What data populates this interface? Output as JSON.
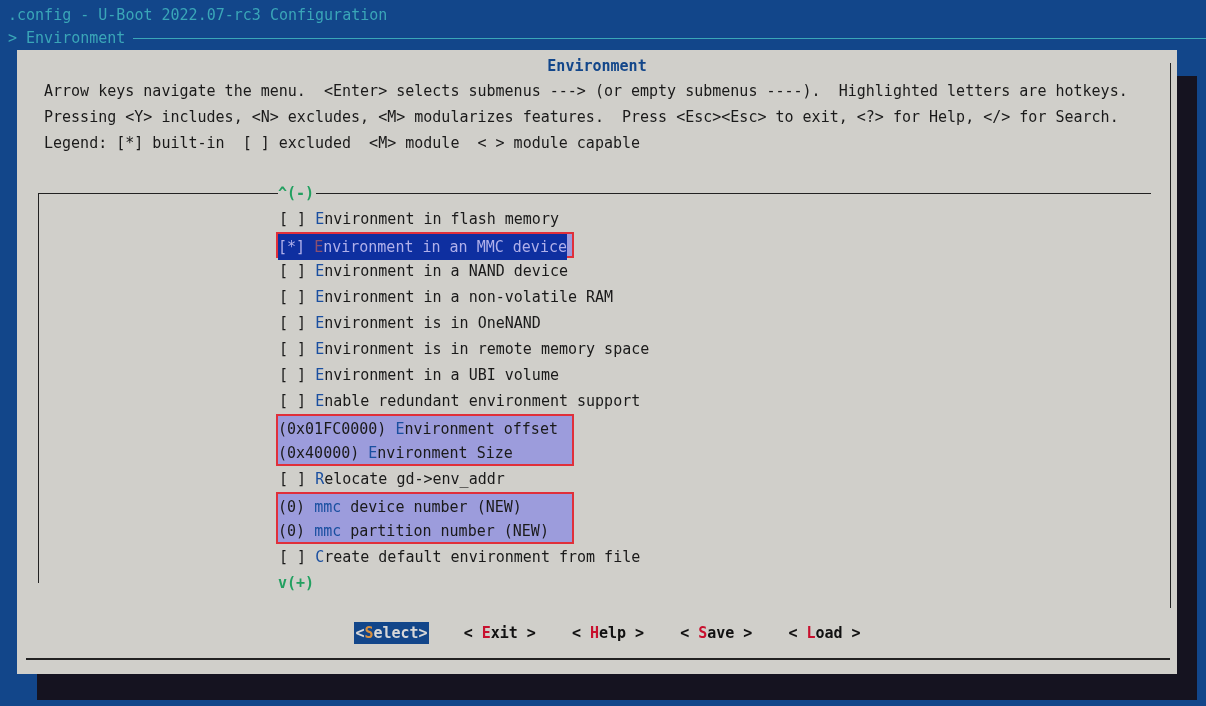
{
  "window": {
    "title": ".config - U-Boot 2022.07-rc3 Configuration"
  },
  "breadcrumb": "> Environment",
  "dialog": {
    "title": "Environment",
    "help_lines": [
      "Arrow keys navigate the menu.  <Enter> selects submenus ---> (or empty submenus ----).  Highlighted letters are hotkeys.",
      "Pressing <Y> includes, <N> excludes, <M> modularizes features.  Press <Esc><Esc> to exit, <?> for Help, </> for Search.",
      "Legend: [*] built-in  [ ] excluded  <M> module  < > module capable"
    ],
    "scroll_up": "^(-)",
    "scroll_down": "v(+)",
    "items": [
      {
        "prefix": "[ ]",
        "hotkey": "E",
        "rest": "nvironment in flash memory",
        "selected": false,
        "marked": false
      },
      {
        "prefix": "[*]",
        "hotkey": "E",
        "rest": "nvironment in an MMC device",
        "selected": true,
        "marked": true
      },
      {
        "prefix": "[ ]",
        "hotkey": "E",
        "rest": "nvironment in a NAND device",
        "selected": false,
        "marked": false
      },
      {
        "prefix": "[ ]",
        "hotkey": "E",
        "rest": "nvironment in a non-volatile RAM",
        "selected": false,
        "marked": false
      },
      {
        "prefix": "[ ]",
        "hotkey": "E",
        "rest": "nvironment is in OneNAND",
        "selected": false,
        "marked": false
      },
      {
        "prefix": "[ ]",
        "hotkey": "E",
        "rest": "nvironment is in remote memory space",
        "selected": false,
        "marked": false
      },
      {
        "prefix": "[ ]",
        "hotkey": "E",
        "rest": "nvironment in a UBI volume",
        "selected": false,
        "marked": false
      },
      {
        "prefix": "[ ]",
        "hotkey": "E",
        "rest": "nable redundant environment support",
        "selected": false,
        "marked": false
      },
      {
        "prefix": "(0x01FC0000)",
        "hotkey": "E",
        "rest": "nvironment offset",
        "selected": false,
        "marked": true
      },
      {
        "prefix": "(0x40000)",
        "hotkey": "E",
        "rest": "nvironment Size",
        "selected": false,
        "marked": true
      },
      {
        "prefix": "[ ]",
        "hotkey": "R",
        "rest": "elocate gd->env_addr",
        "selected": false,
        "marked": false
      },
      {
        "prefix": "(0)",
        "hotkey": "mmc",
        "rest": " device number (NEW)",
        "selected": false,
        "marked": true
      },
      {
        "prefix": "(0)",
        "hotkey": "mmc",
        "rest": " partition number (NEW)",
        "selected": false,
        "marked": true
      },
      {
        "prefix": "[ ]",
        "hotkey": "C",
        "rest": "reate default environment from file",
        "selected": false,
        "marked": false
      }
    ],
    "buttons": [
      {
        "open": "<",
        "hotkey": "S",
        "rest": "elect",
        "close": ">",
        "selected": true
      },
      {
        "open": "< ",
        "hotkey": "E",
        "rest": "xit",
        "close": " >",
        "selected": false
      },
      {
        "open": "< ",
        "hotkey": "H",
        "rest": "elp",
        "close": " >",
        "selected": false
      },
      {
        "open": "< ",
        "hotkey": "S",
        "rest": "ave",
        "close": " >",
        "selected": false
      },
      {
        "open": "< ",
        "hotkey": "L",
        "rest": "oad",
        "close": " >",
        "selected": false
      }
    ]
  }
}
